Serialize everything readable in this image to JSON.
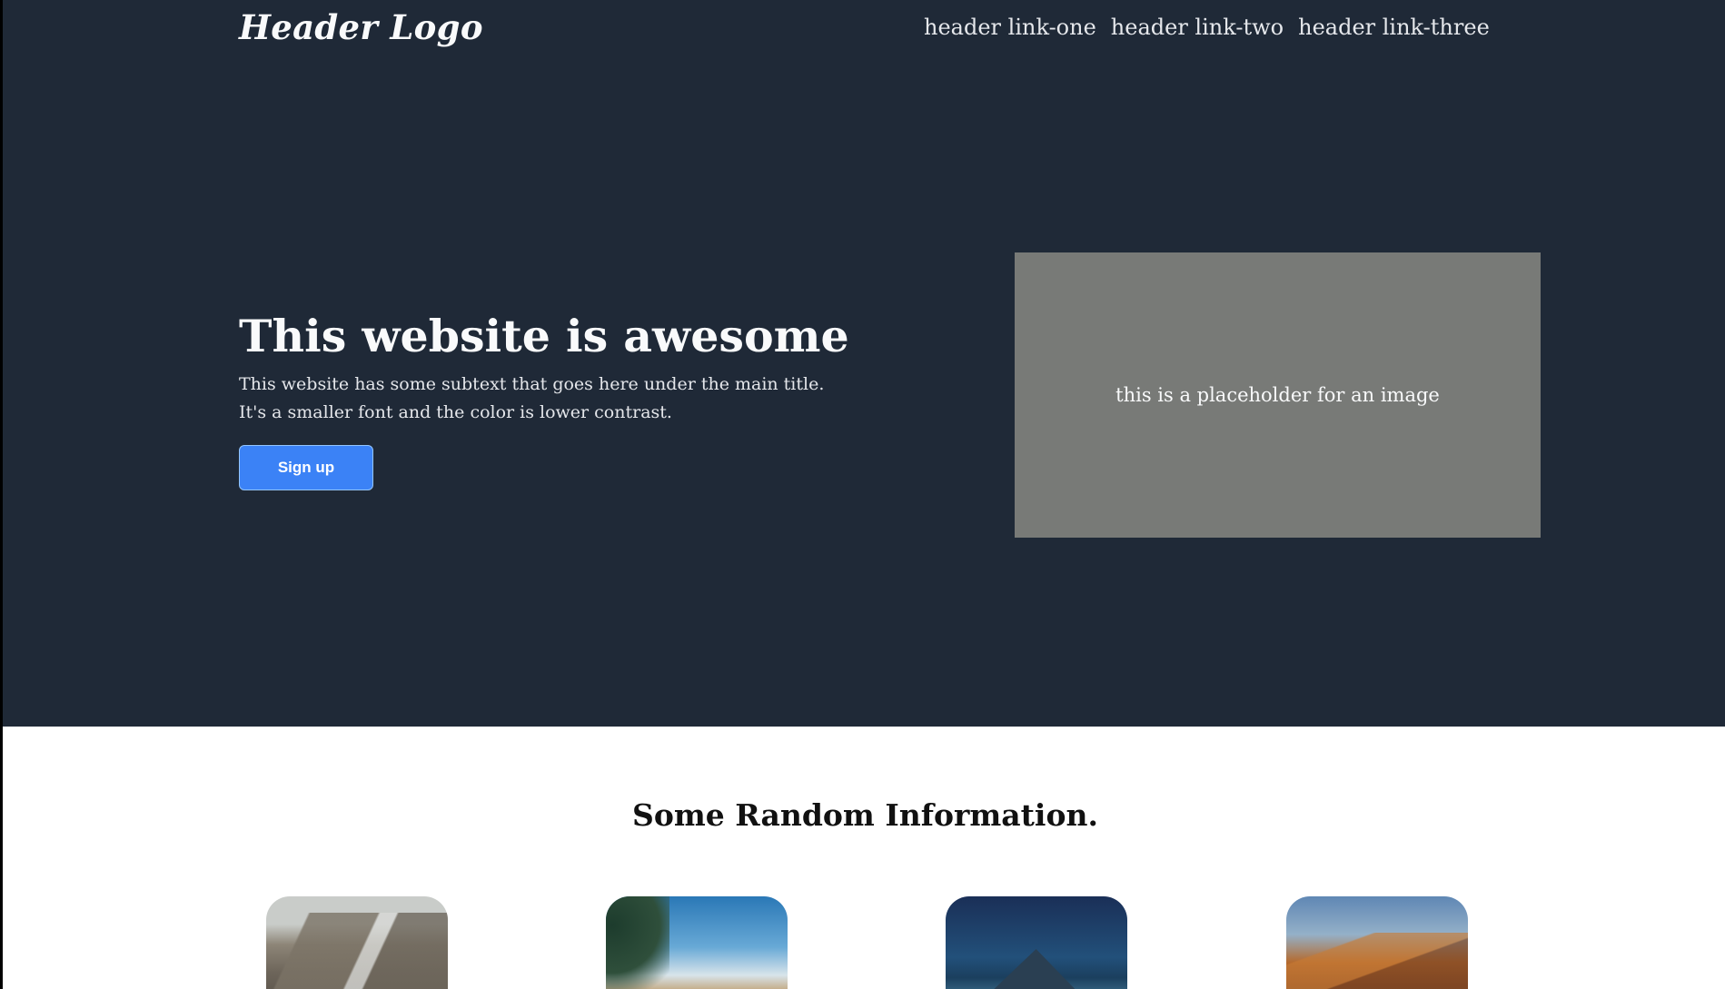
{
  "header": {
    "logo": "Header Logo",
    "links": [
      "header link-one",
      "header link-two",
      "header link-three"
    ]
  },
  "hero": {
    "title": "This website is awesome",
    "subtext": "This website has some subtext that goes here under the main title. It's a smaller font and the color is lower contrast.",
    "signup_button": "Sign up",
    "image_placeholder_text": "this is a placeholder for an image"
  },
  "info": {
    "title": "Some Random Information."
  },
  "colors": {
    "hero_background": "#1f2937",
    "button_background": "#3b82f6",
    "placeholder_background": "#787a77",
    "page_background": "#ffffff"
  }
}
